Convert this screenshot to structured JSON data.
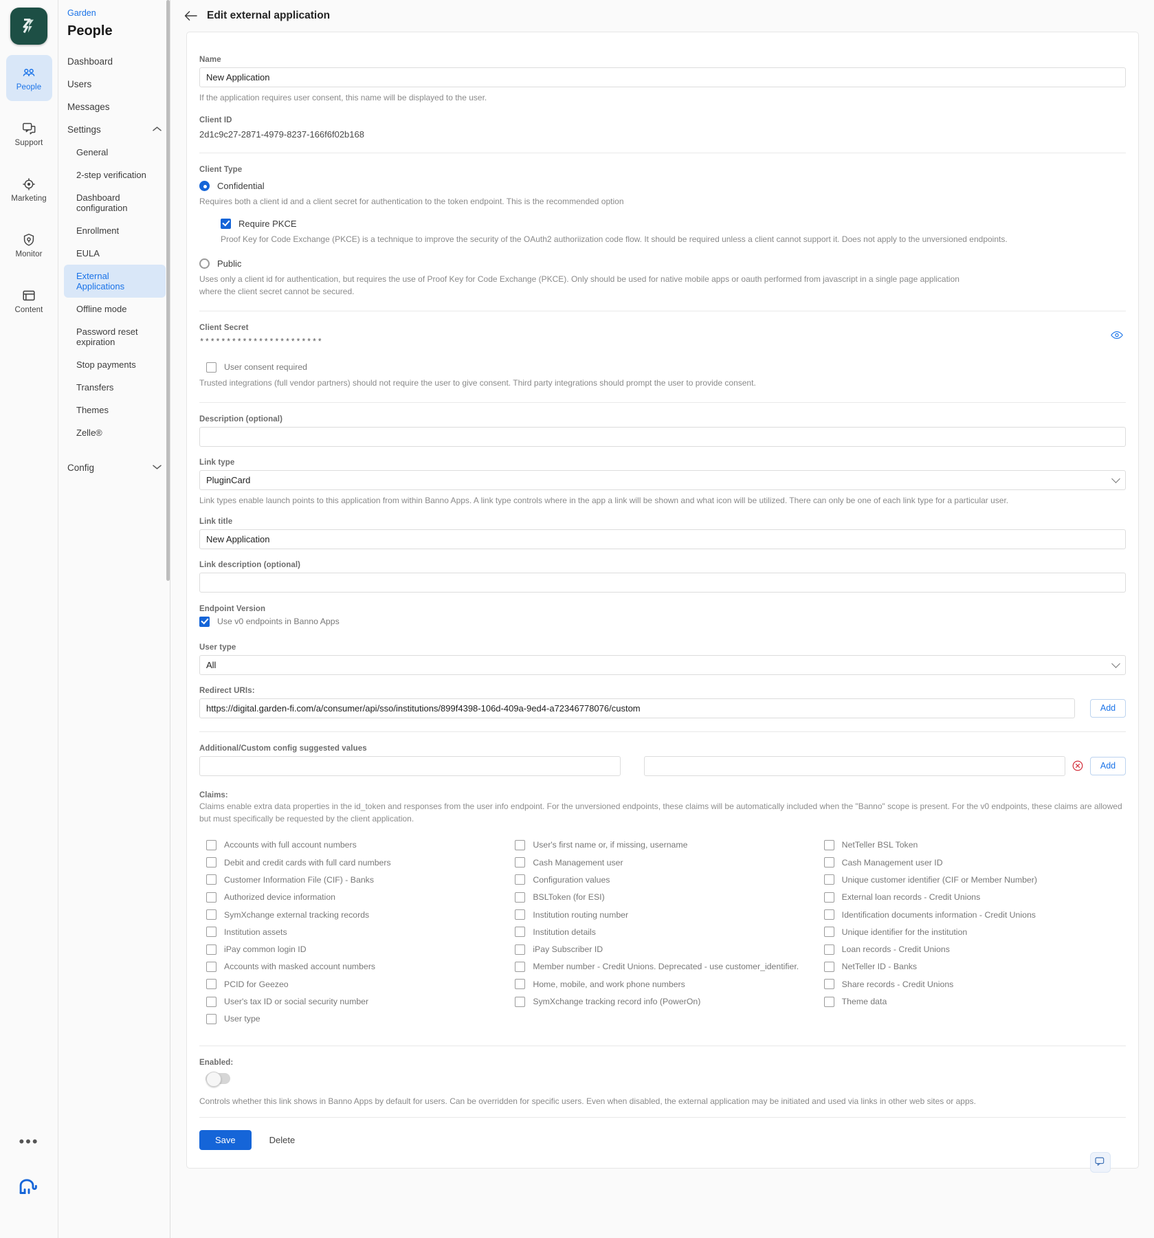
{
  "rail": {
    "logo_name": "banno-logo",
    "items": [
      {
        "label": "People",
        "icon": "people-icon",
        "active": true
      },
      {
        "label": "Support",
        "icon": "chat-bubbles-icon",
        "active": false
      },
      {
        "label": "Marketing",
        "icon": "target-icon",
        "active": false
      },
      {
        "label": "Monitor",
        "icon": "shield-icon",
        "active": false
      },
      {
        "label": "Content",
        "icon": "browser-window-icon",
        "active": false
      }
    ],
    "more_label": "•••"
  },
  "sidebar": {
    "breadcrumb": "Garden",
    "title": "People",
    "items": [
      {
        "label": "Dashboard",
        "type": "top"
      },
      {
        "label": "Users",
        "type": "top"
      },
      {
        "label": "Messages",
        "type": "top"
      },
      {
        "label": "Settings",
        "type": "group",
        "expanded": true,
        "chevron": "chevron-up"
      },
      {
        "label": "General",
        "type": "sub"
      },
      {
        "label": "2-step verification",
        "type": "sub"
      },
      {
        "label": "Dashboard configuration",
        "type": "sub"
      },
      {
        "label": "Enrollment",
        "type": "sub"
      },
      {
        "label": "EULA",
        "type": "sub"
      },
      {
        "label": "External Applications",
        "type": "sub",
        "active": true
      },
      {
        "label": "Offline mode",
        "type": "sub"
      },
      {
        "label": "Password reset expiration",
        "type": "sub"
      },
      {
        "label": "Stop payments",
        "type": "sub"
      },
      {
        "label": "Transfers",
        "type": "sub"
      },
      {
        "label": "Themes",
        "type": "sub"
      },
      {
        "label": "Zelle®",
        "type": "sub"
      },
      {
        "label": "Config",
        "type": "group",
        "expanded": false,
        "chevron": "chevron-down"
      }
    ]
  },
  "header": {
    "back_icon": "arrow-left-icon",
    "title": "Edit external application"
  },
  "form": {
    "name_label": "Name",
    "name_value": "New Application",
    "name_help": "If the application requires user consent, this name will be displayed to the user.",
    "client_id_label": "Client ID",
    "client_id_value": "2d1c9c27-2871-4979-8237-166f6f02b168",
    "client_type_label": "Client Type",
    "confidential_label": "Confidential",
    "confidential_selected": true,
    "confidential_help": "Requires both a client id and a client secret for authentication to the token endpoint. This is the recommended option",
    "pkce_label": "Require PKCE",
    "pkce_checked": true,
    "pkce_help": "Proof Key for Code Exchange (PKCE) is a technique to improve the security of the OAuth2 authoriization code flow. It should be required unless a client cannot support it. Does not apply to the unversioned endpoints.",
    "public_label": "Public",
    "public_selected": false,
    "public_help": "Uses only a client id for authentication, but requires the use of Proof Key for Code Exchange (PKCE). Only should be used for native mobile apps or oauth performed from javascript in a single page application where the client secret cannot be secured.",
    "client_secret_label": "Client Secret",
    "client_secret_value": "***********************",
    "reveal_icon": "eye-icon",
    "consent_label": "User consent required",
    "consent_checked": false,
    "consent_help": "Trusted integrations (full vendor partners) should not require the user to give consent. Third party integrations should prompt the user to provide consent.",
    "description_label": "Description (optional)",
    "description_value": "",
    "link_type_label": "Link type",
    "link_type_value": "PluginCard",
    "link_type_options": [
      "PluginCard"
    ],
    "link_type_help": "Link types enable launch points to this application from within Banno Apps. A link type controls where in the app a link will be shown and what icon will be utilized. There can only be one of each link type for a particular user.",
    "link_title_label": "Link title",
    "link_title_value": "New Application",
    "link_description_label": "Link description (optional)",
    "link_description_value": "",
    "endpoint_version_label": "Endpoint Version",
    "v0_label": "Use v0 endpoints in Banno Apps",
    "v0_checked": true,
    "user_type_label": "User type",
    "user_type_value": "All",
    "user_type_options": [
      "All"
    ],
    "redirect_uris_label": "Redirect URIs:",
    "redirect_uri_value": "https://digital.garden-fi.com/a/consumer/api/sso/institutions/899f4398-106d-409a-9ed4-a72346778076/custom",
    "redirect_add_label": "Add",
    "custom_config_label": "Additional/Custom config suggested values",
    "custom_config_key": "",
    "custom_config_val": "",
    "custom_config_add_label": "Add",
    "custom_config_remove_icon": "remove-circle-icon",
    "claims_label": "Claims:",
    "claims_desc": "Claims enable extra data properties in the id_token and responses from the user info endpoint. For the unversioned endpoints, these claims will be automatically included when the \"Banno\" scope is present. For the v0 endpoints, these claims are allowed but must specifically be requested by the client application.",
    "enabled_label": "Enabled:",
    "enabled_checked": false,
    "enabled_help": "Controls whether this link shows in Banno Apps by default for users. Can be overridden for specific users. Even when disabled, the external application may be initiated and used via links in other web sites or apps.",
    "save_label": "Save",
    "delete_label": "Delete"
  },
  "claims_columns": [
    [
      "Accounts with full account numbers",
      "Debit and credit cards with full card numbers",
      "Customer Information File (CIF) - Banks",
      "Authorized device information",
      "SymXchange external tracking records",
      "Institution assets",
      "iPay common login ID",
      "Accounts with masked account numbers",
      "PCID for Geezeo",
      "User's tax ID or social security number",
      "User type"
    ],
    [
      "User's first name or, if missing, username",
      "Cash Management user",
      "Configuration values",
      "BSLToken (for ESI)",
      "Institution routing number",
      "Institution details",
      "iPay Subscriber ID",
      "Member number - Credit Unions. Deprecated - use customer_identifier.",
      "Home, mobile, and work phone numbers",
      "SymXchange tracking record info (PowerOn)"
    ],
    [
      "NetTeller BSL Token",
      "Cash Management user ID",
      "Unique customer identifier (CIF or Member Number)",
      "External loan records - Credit Unions",
      "Identification documents information - Credit Unions",
      "Unique identifier for the institution",
      "Loan records - Credit Unions",
      "NetTeller ID - Banks",
      "Share records - Credit Unions",
      "Theme data"
    ]
  ],
  "colors": {
    "accent": "#1a73e8",
    "primary_button": "#1565d8",
    "sidebar_active_bg": "#d9e7f8",
    "logo_bg": "#1d4f45"
  }
}
